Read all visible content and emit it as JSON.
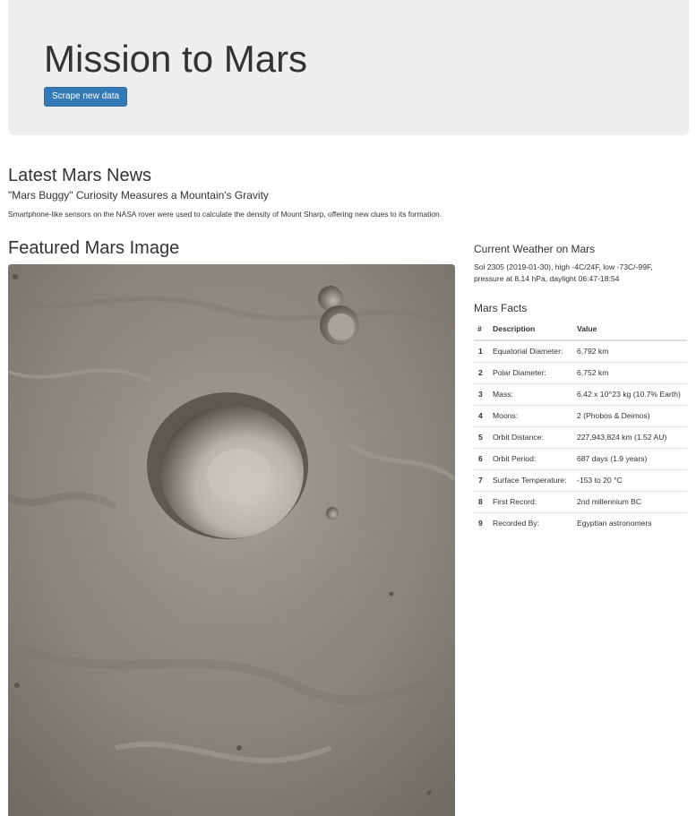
{
  "header": {
    "title": "Mission to Mars",
    "scrape_button": "Scrape new data"
  },
  "news": {
    "section_title": "Latest Mars News",
    "headline": "\"Mars Buggy\" Curiosity Measures a Mountain's Gravity",
    "teaser": "Smartphone-like sensors on the NASA rover were used to calculate the density of Mount Sharp, offering new clues to its formation."
  },
  "featured": {
    "section_title": "Featured Mars Image",
    "image_icon": "mars-crater-photo"
  },
  "weather": {
    "section_title": "Current Weather on Mars",
    "text": "Sol 2305 (2019-01-30), high -4C/24F, low -73C/-99F, pressure at 8.14 hPa, daylight 06:47-18:54"
  },
  "facts": {
    "section_title": "Mars Facts",
    "columns": [
      "#",
      "Description",
      "Value"
    ],
    "rows": [
      {
        "num": "1",
        "desc": "Equatorial Diameter:",
        "value": "6,792 km"
      },
      {
        "num": "2",
        "desc": "Polar Diameter:",
        "value": "6,752 km"
      },
      {
        "num": "3",
        "desc": "Mass:",
        "value": "6.42 x 10^23 kg (10.7% Earth)"
      },
      {
        "num": "4",
        "desc": "Moons:",
        "value": "2 (Phobos & Deimos)"
      },
      {
        "num": "5",
        "desc": "Orbit Distance:",
        "value": "227,943,824 km (1.52 AU)"
      },
      {
        "num": "6",
        "desc": "Orbit Period:",
        "value": "687 days (1.9 years)"
      },
      {
        "num": "7",
        "desc": "Surface Temperature:",
        "value": "-153 to 20 °C"
      },
      {
        "num": "8",
        "desc": "First Record:",
        "value": "2nd millennium BC"
      },
      {
        "num": "9",
        "desc": "Recorded By:",
        "value": "Egyptian astronomers"
      }
    ]
  },
  "colors": {
    "jumbotron_bg": "#eeeeee",
    "button_bg": "#337ab7",
    "text": "#333333"
  }
}
